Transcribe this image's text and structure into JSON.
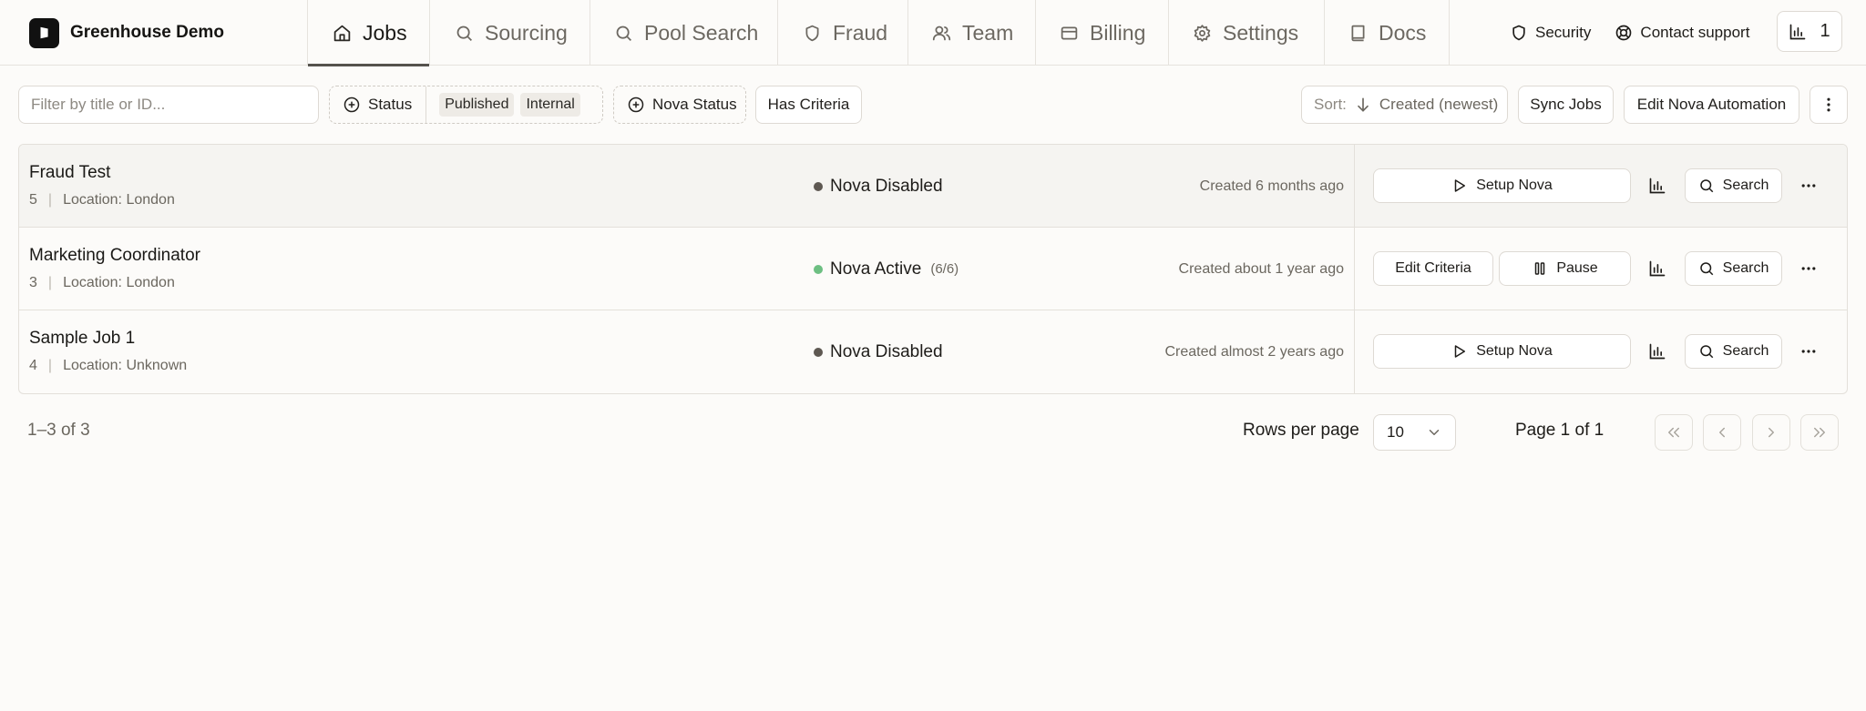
{
  "brand": {
    "name": "Greenhouse Demo"
  },
  "nav": {
    "tabs": [
      {
        "label": "Jobs",
        "icon": "home-icon",
        "active": true
      },
      {
        "label": "Sourcing",
        "icon": "search-icon"
      },
      {
        "label": "Pool Search",
        "icon": "search-icon"
      },
      {
        "label": "Fraud",
        "icon": "shield-icon"
      },
      {
        "label": "Team",
        "icon": "users-icon"
      },
      {
        "label": "Billing",
        "icon": "credit-card-icon"
      },
      {
        "label": "Settings",
        "icon": "gear-icon"
      },
      {
        "label": "Docs",
        "icon": "book-icon"
      }
    ],
    "security_label": "Security",
    "support_label": "Contact support",
    "stat_value": "1"
  },
  "filters": {
    "search_placeholder": "Filter by title or ID...",
    "status_label": "Status",
    "status_values": [
      "Published",
      "Internal"
    ],
    "nova_status_label": "Nova Status",
    "has_criteria_label": "Has Criteria",
    "sort_prefix": "Sort:",
    "sort_value": "Created (newest)",
    "sync_label": "Sync Jobs",
    "edit_automation_label": "Edit Nova Automation"
  },
  "jobs": [
    {
      "title": "Fraud Test",
      "id": "5",
      "location": "Location: London",
      "nova_status": "Nova Disabled",
      "nova_count": "",
      "status_color": "#5e5852",
      "created": "Created 6 months ago",
      "actions": [
        "Setup Nova"
      ],
      "search_label": "Search"
    },
    {
      "title": "Marketing Coordinator",
      "id": "3",
      "location": "Location: London",
      "nova_status": "Nova Active",
      "nova_count": "(6/6)",
      "status_color": "#6dbf82",
      "created": "Created about 1 year ago",
      "actions": [
        "Edit Criteria",
        "Pause"
      ],
      "search_label": "Search"
    },
    {
      "title": "Sample Job 1",
      "id": "4",
      "location": "Location: Unknown",
      "nova_status": "Nova Disabled",
      "nova_count": "",
      "status_color": "#5e5852",
      "created": "Created almost 2 years ago",
      "actions": [
        "Setup Nova"
      ],
      "search_label": "Search"
    }
  ],
  "pagination": {
    "range": "1–3 of 3",
    "rows_per_page_label": "Rows per page",
    "rows_per_page_value": "10",
    "page_label": "Page 1 of 1"
  }
}
